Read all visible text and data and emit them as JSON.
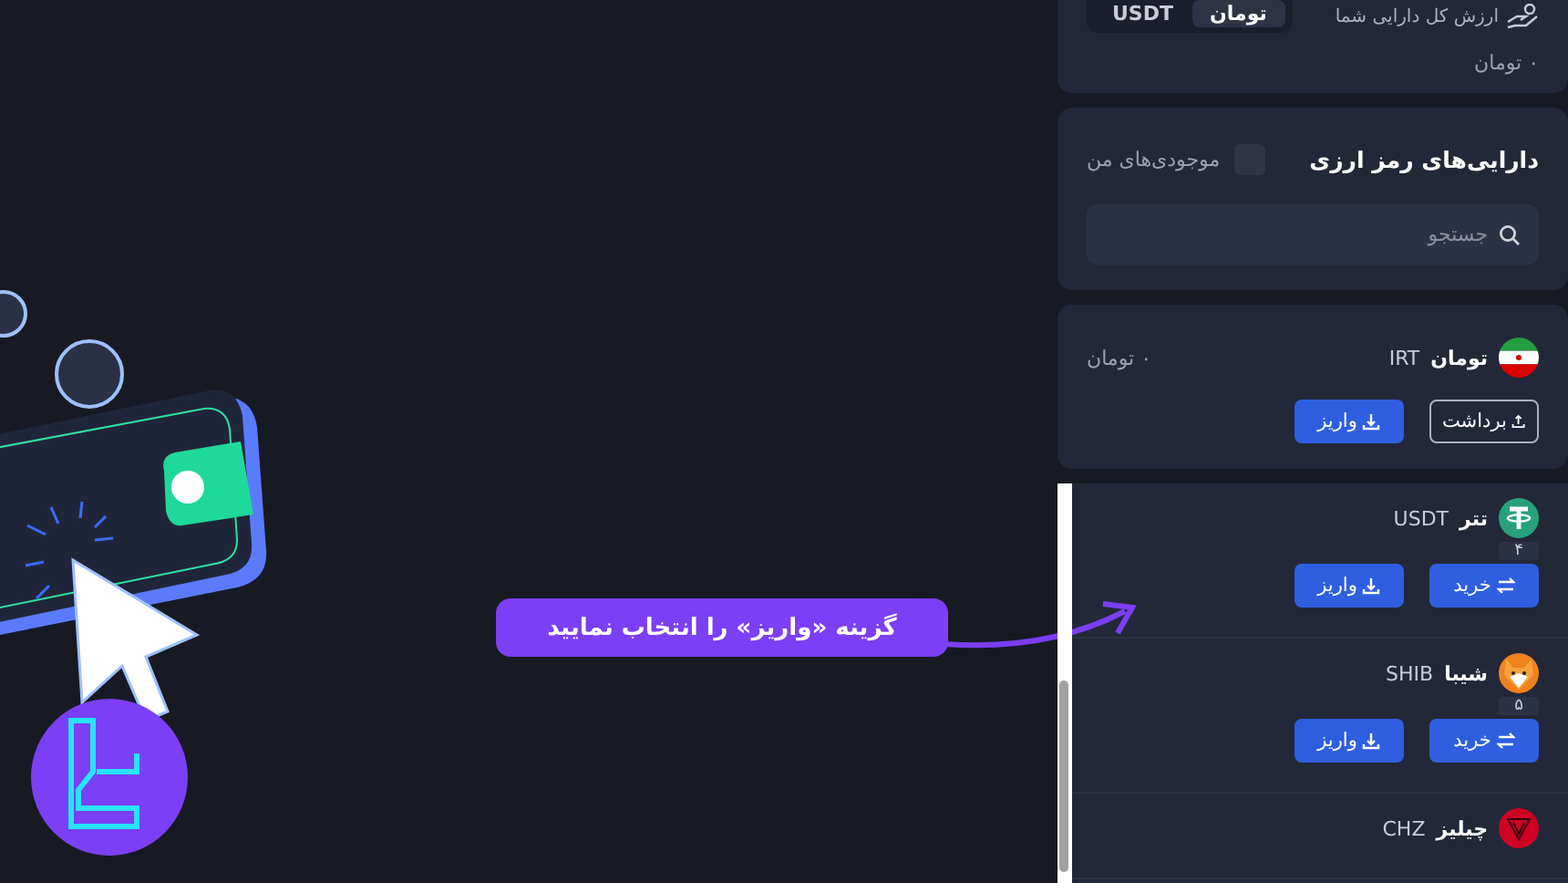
{
  "balance": {
    "title": "ارزش کل دارایی شما",
    "tabs": [
      {
        "label": "تومان",
        "selected": true
      },
      {
        "label": "USDT",
        "selected": false
      }
    ],
    "amount": "۰ تومان"
  },
  "assets": {
    "title": "دارایی‌های رمز ارزی",
    "filter": {
      "label": "موجودی‌های من",
      "checked": false
    },
    "search": {
      "placeholder": "جستجو"
    }
  },
  "fiat": {
    "name": "تومان",
    "symbol": "IRT",
    "balance": "۰ تومان",
    "buttons": [
      {
        "kind": "withdraw",
        "label": "برداشت"
      },
      {
        "kind": "deposit",
        "label": "واریز"
      }
    ]
  },
  "coins": [
    {
      "name": "تتر",
      "symbol": "USDT",
      "balance": "۴",
      "buttons": [
        {
          "kind": "buy",
          "label": "خرید"
        },
        {
          "kind": "deposit",
          "label": "واریز"
        }
      ]
    },
    {
      "name": "شیبا",
      "symbol": "SHIB",
      "balance": "۵",
      "buttons": [
        {
          "kind": "buy",
          "label": "خرید"
        },
        {
          "kind": "deposit",
          "label": "واریز"
        }
      ]
    },
    {
      "name": "چیلیز",
      "symbol": "CHZ"
    }
  ],
  "callout": {
    "text": "گزینه «واریز» را انتخاب نمایید"
  }
}
